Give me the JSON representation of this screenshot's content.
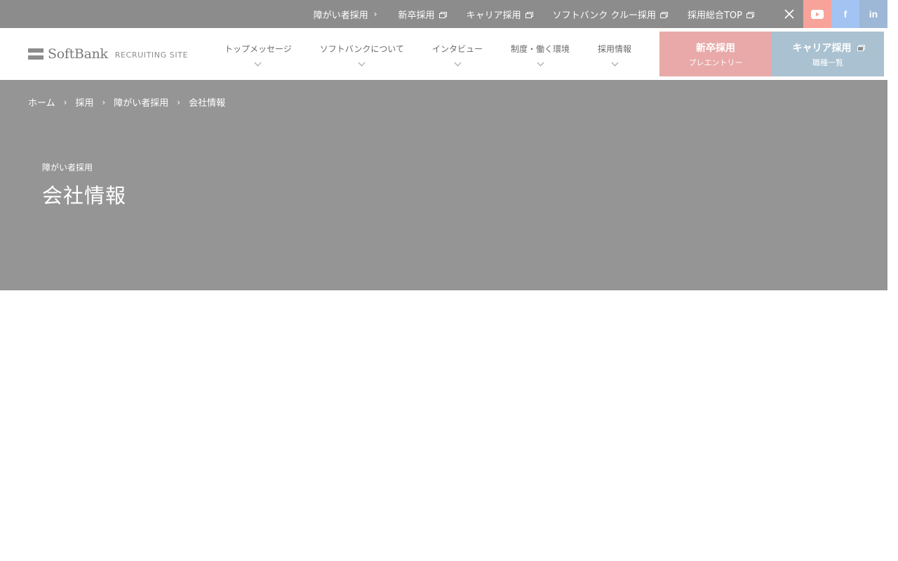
{
  "topbar": {
    "links": [
      {
        "label": "障がい者採用",
        "icon": "chevron-right-icon"
      },
      {
        "label": "新卒採用",
        "icon": "external-link-icon"
      },
      {
        "label": "キャリア採用",
        "icon": "external-link-icon"
      },
      {
        "label": "ソフトバンク クルー採用",
        "icon": "external-link-icon"
      },
      {
        "label": "採用総合TOP",
        "icon": "external-link-icon"
      }
    ],
    "social": [
      "x-icon",
      "youtube-icon",
      "facebook-icon",
      "linkedin-icon"
    ]
  },
  "header": {
    "logo": "SoftBank",
    "logo_sub": "RECRUITING SITE",
    "nav": [
      {
        "label": "トップメッセージ"
      },
      {
        "label": "ソフトバンクについて"
      },
      {
        "label": "インタビュー"
      },
      {
        "label": "制度・働く環境"
      },
      {
        "label": "採用情報"
      }
    ],
    "cta_new": {
      "main": "新卒採用",
      "sub": "プレエントリー"
    },
    "cta_career": {
      "main": "キャリア採用",
      "sub": "職種一覧"
    }
  },
  "breadcrumb": [
    "ホーム",
    "採用",
    "障がい者採用",
    "会社情報"
  ],
  "hero": {
    "subtitle": "障がい者採用",
    "title": "会社情報"
  },
  "colors": {
    "topbar": "#8c8c8c",
    "hero": "#959595",
    "cta_new": "#e8a9a8",
    "cta_career": "#a9c1d0",
    "youtube": "#f7a39a",
    "facebook": "#a3c4f3",
    "linkedin": "#9db7d6"
  }
}
